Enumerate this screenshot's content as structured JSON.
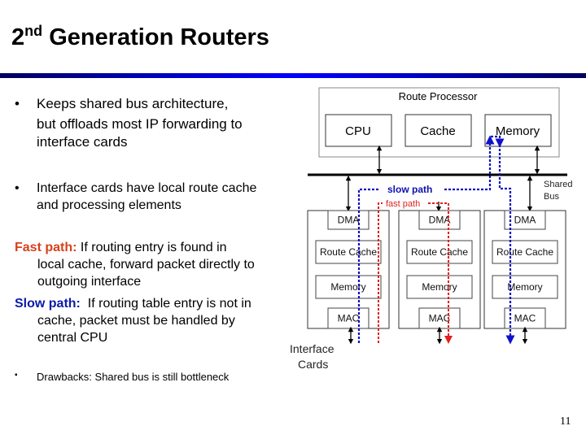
{
  "slide": {
    "title_prefix": "2",
    "title_superscript": "nd",
    "title_rest": " Generation Routers",
    "page_number": "11",
    "accent_rule_color": "#0000ff"
  },
  "bullets": [
    {
      "marker": "•",
      "lines": [
        "Keeps shared bus architecture,",
        "but offloads most IP forwarding to",
        "interface cards"
      ]
    },
    {
      "marker": "•",
      "lines": [
        "Interface cards have local route cache",
        "and processing elements"
      ]
    }
  ],
  "paths": {
    "fast": {
      "label": "Fast path:",
      "color": "#d8401a",
      "lines": [
        " If routing entry is found in",
        "local cache, forward packet directly to",
        "outgoing interface"
      ]
    },
    "slow": {
      "label": "Slow path:",
      "color": "#0a1aa8",
      "lines": "  If routing table entry is not in",
      "lines2": [
        "cache, packet must be handled by",
        "central CPU"
      ]
    }
  },
  "drawbacks": {
    "marker": "▪",
    "text": "Drawbacks: Shared bus is still bottleneck"
  },
  "diagram": {
    "route_processor": {
      "label": "Route Processor",
      "blocks": [
        "CPU",
        "Cache",
        "Memory"
      ]
    },
    "shared_bus_label": [
      "Shared",
      "Bus"
    ],
    "slow_path_label": "slow path",
    "fast_path_label": "fast path",
    "slow_path_color": "#1010c0",
    "fast_path_color": "#e02020",
    "interface_cards_label": [
      "Interface",
      "Cards"
    ],
    "cards": [
      {
        "dma": "DMA",
        "route_cache": "Route Cache",
        "memory": "Memory",
        "mac": "MAC"
      },
      {
        "dma": "DMA",
        "route_cache": "Route Cache",
        "memory": "Memory",
        "mac": "MAC"
      },
      {
        "dma": "DMA",
        "route_cache": "Route Cache",
        "memory": "Memory",
        "mac": "MAC"
      }
    ]
  }
}
